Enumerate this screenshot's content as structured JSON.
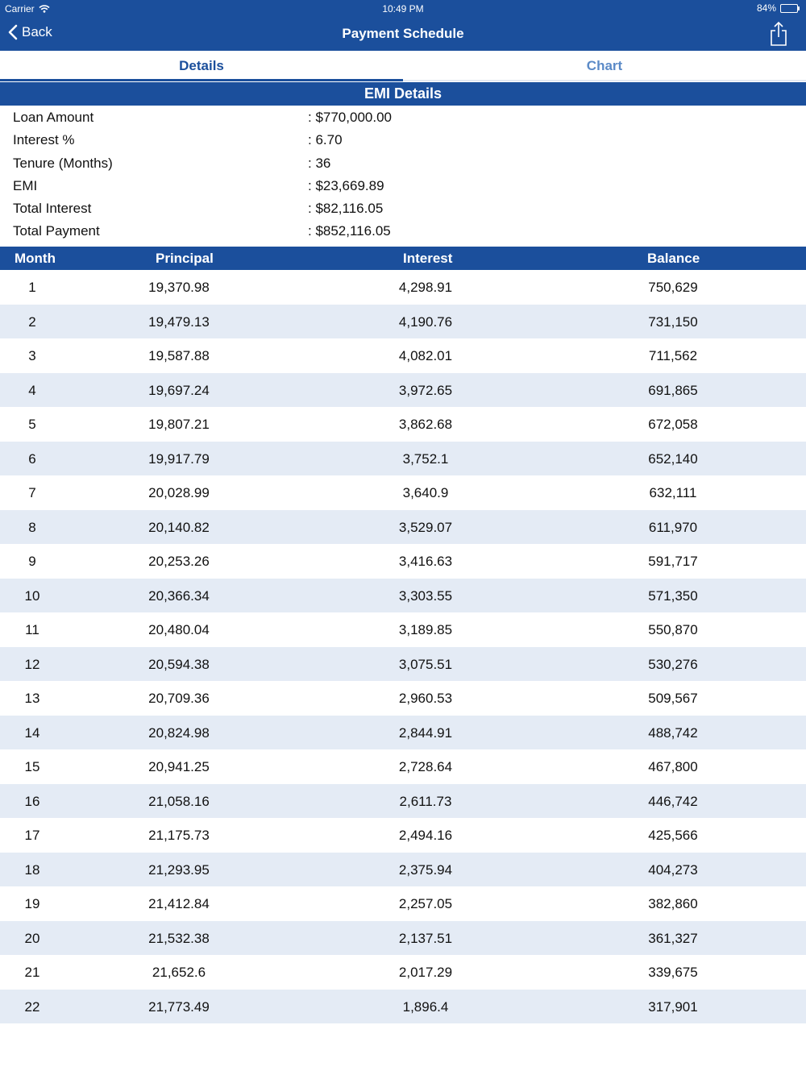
{
  "status_bar": {
    "carrier": "Carrier",
    "time": "10:49 PM",
    "battery": "84%",
    "battery_level": 0.84
  },
  "nav": {
    "back_label": "Back",
    "title": "Payment Schedule"
  },
  "tabs": [
    {
      "label": "Details"
    },
    {
      "label": "Chart"
    }
  ],
  "emi": {
    "header": "EMI Details",
    "rows": [
      {
        "label": "Loan Amount",
        "value": ": $770,000.00"
      },
      {
        "label": "Interest %",
        "value": ": 6.70"
      },
      {
        "label": "Tenure (Months)",
        "value": ": 36"
      },
      {
        "label": "EMI",
        "value": ": $23,669.89"
      },
      {
        "label": "Total Interest",
        "value": ": $82,116.05"
      },
      {
        "label": "Total Payment",
        "value": ": $852,116.05"
      }
    ]
  },
  "schedule": {
    "columns": [
      "Month",
      "Principal",
      "Interest",
      "Balance"
    ],
    "rows": [
      [
        "1",
        "19,370.98",
        "4,298.91",
        "750,629"
      ],
      [
        "2",
        "19,479.13",
        "4,190.76",
        "731,150"
      ],
      [
        "3",
        "19,587.88",
        "4,082.01",
        "711,562"
      ],
      [
        "4",
        "19,697.24",
        "3,972.65",
        "691,865"
      ],
      [
        "5",
        "19,807.21",
        "3,862.68",
        "672,058"
      ],
      [
        "6",
        "19,917.79",
        "3,752.1",
        "652,140"
      ],
      [
        "7",
        "20,028.99",
        "3,640.9",
        "632,111"
      ],
      [
        "8",
        "20,140.82",
        "3,529.07",
        "611,970"
      ],
      [
        "9",
        "20,253.26",
        "3,416.63",
        "591,717"
      ],
      [
        "10",
        "20,366.34",
        "3,303.55",
        "571,350"
      ],
      [
        "11",
        "20,480.04",
        "3,189.85",
        "550,870"
      ],
      [
        "12",
        "20,594.38",
        "3,075.51",
        "530,276"
      ],
      [
        "13",
        "20,709.36",
        "2,960.53",
        "509,567"
      ],
      [
        "14",
        "20,824.98",
        "2,844.91",
        "488,742"
      ],
      [
        "15",
        "20,941.25",
        "2,728.64",
        "467,800"
      ],
      [
        "16",
        "21,058.16",
        "2,611.73",
        "446,742"
      ],
      [
        "17",
        "21,175.73",
        "2,494.16",
        "425,566"
      ],
      [
        "18",
        "21,293.95",
        "2,375.94",
        "404,273"
      ],
      [
        "19",
        "21,412.84",
        "2,257.05",
        "382,860"
      ],
      [
        "20",
        "21,532.38",
        "2,137.51",
        "361,327"
      ],
      [
        "21",
        "21,652.6",
        "2,017.29",
        "339,675"
      ],
      [
        "22",
        "21,773.49",
        "1,896.4",
        "317,901"
      ]
    ]
  },
  "colors": {
    "brand": "#1b4f9c",
    "row_alt": "#e4ebf5",
    "tab_inactive": "#5b8ac7"
  },
  "icons": {
    "back": "chevron-left-icon",
    "share": "share-icon",
    "wifi": "wifi-icon",
    "battery": "battery-icon"
  }
}
